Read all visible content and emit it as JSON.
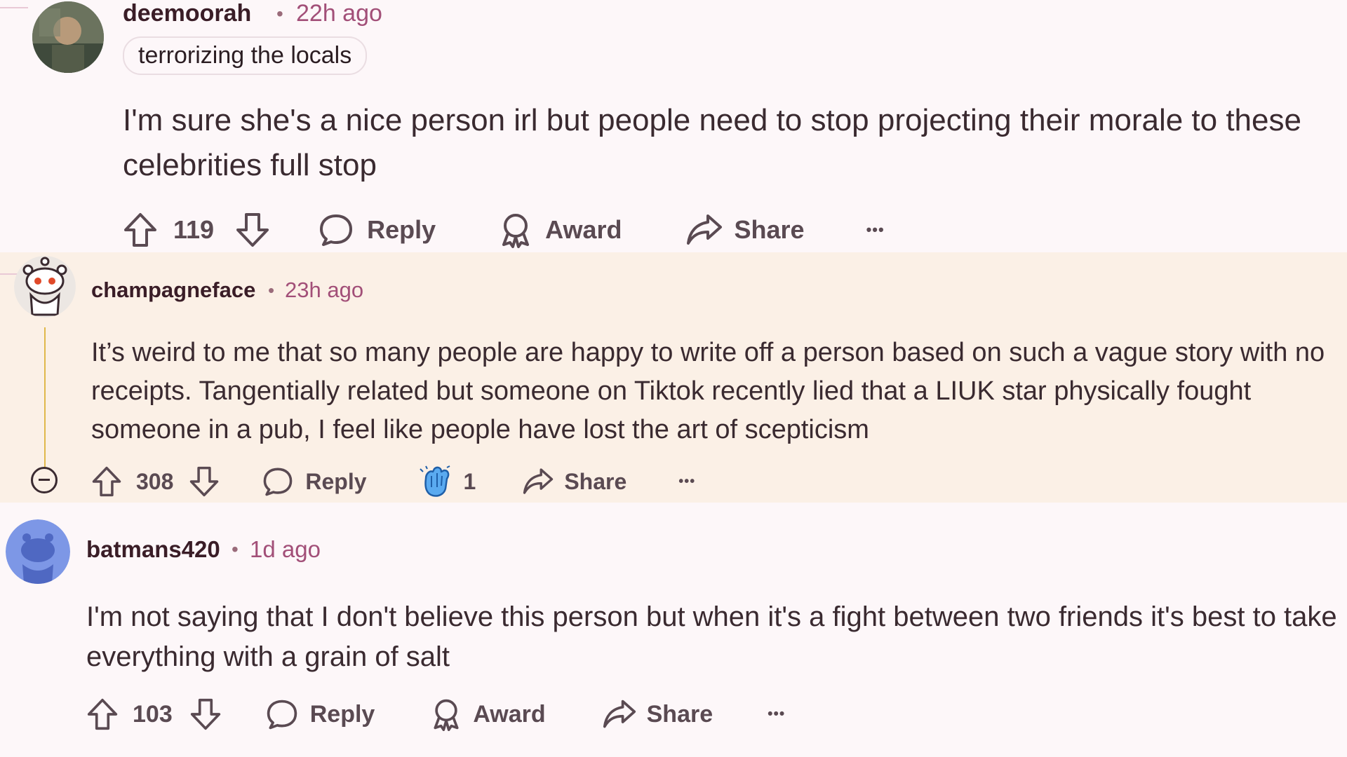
{
  "comments": [
    {
      "username": "deemoorah",
      "separator": "•",
      "time": "22h ago",
      "flair": "terrorizing the locals",
      "body": "I'm sure she's a nice person irl but people need to stop projecting their morale to these celebrities full stop",
      "upvotes": "119",
      "reply_label": "Reply",
      "award_label": "Award",
      "share_label": "Share",
      "more_label": "•••"
    },
    {
      "username": "champagneface",
      "separator": "•",
      "time": "23h ago",
      "body": "It’s weird to me that so many people are happy to write off a person based on such a vague story with no receipts. Tangentially related but someone on Tiktok recently lied that a LIUK star physically fought someone in a pub, I feel like people have lost the art of scepticism",
      "upvotes": "308",
      "reply_label": "Reply",
      "award_count": "1",
      "share_label": "Share",
      "more_label": "•••"
    },
    {
      "username": "batmans420",
      "separator": "•",
      "time": "1d ago",
      "body": "I'm not saying that I don't believe this person but when it's a fight between two friends it's best to take everything with a grain of salt",
      "upvotes": "103",
      "reply_label": "Reply",
      "award_label": "Award",
      "share_label": "Share",
      "more_label": "•••"
    }
  ],
  "colors": {
    "background": "#fdf7f9",
    "highlight": "#fbf0e6",
    "time": "#a24f78",
    "thread_line": "#e0b84a"
  }
}
